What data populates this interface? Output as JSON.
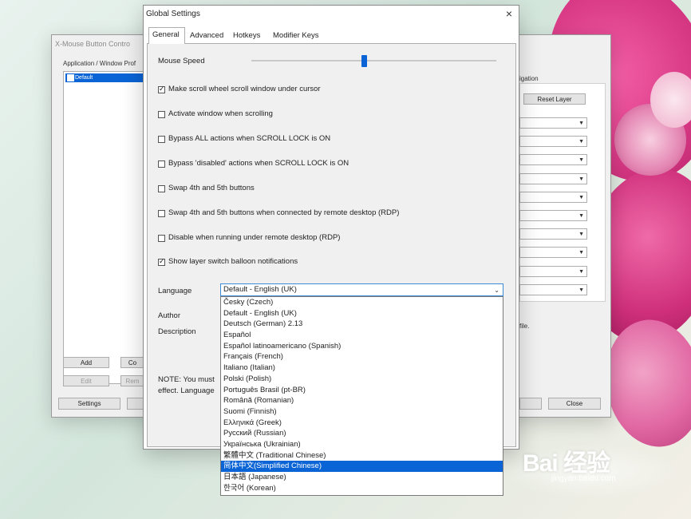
{
  "back_window": {
    "title": "X-Mouse Button Contro",
    "app_list_label": "Application / Window Prof",
    "list_items": [
      "Default"
    ],
    "buttons": {
      "add": "Add",
      "copy": "Co",
      "edit": "Edit",
      "remove": "Rem",
      "settings": "Settings",
      "close": "Close"
    },
    "right_label": "igation",
    "reset_layer": "Reset Layer",
    "profile_note": "file.",
    "combo_count": 10
  },
  "global_settings": {
    "title": "Global Settings",
    "close_glyph": "×",
    "tabs": [
      {
        "label": "General",
        "active": true
      },
      {
        "label": "Advanced",
        "active": false
      },
      {
        "label": "Hotkeys",
        "active": false
      },
      {
        "label": "Modifier Keys",
        "active": false
      }
    ],
    "mouse_speed_label": "Mouse Speed",
    "mouse_speed_value": 0.46,
    "checkboxes": [
      {
        "label": "Make scroll wheel scroll window under cursor",
        "checked": true
      },
      {
        "label": "Activate window when scrolling",
        "checked": false
      },
      {
        "label": "Bypass ALL actions when SCROLL LOCK is ON",
        "checked": false
      },
      {
        "label": "Bypass 'disabled' actions when SCROLL LOCK is ON",
        "checked": false
      },
      {
        "label": "Swap 4th and 5th buttons",
        "checked": false
      },
      {
        "label": "Swap 4th and 5th buttons when connected by remote desktop (RDP)",
        "checked": false
      },
      {
        "label": "Disable when running under remote desktop (RDP)",
        "checked": false
      },
      {
        "label": "Show layer switch balloon notifications",
        "checked": true
      }
    ],
    "language_label": "Language",
    "language_selected": "Default - English (UK)",
    "author_label": "Author",
    "description_label": "Description",
    "note_line1": "NOTE: You must",
    "note_line2": "effect. Language",
    "language_options": [
      "Česky (Czech)",
      "Default - English (UK)",
      "Deutsch (German) 2.13",
      "Español",
      "Español latinoamericano (Spanish)",
      "Français (French)",
      "Italiano (Italian)",
      "Polski (Polish)",
      "Português Brasil (pt-BR)",
      "Română (Romanian)",
      "Suomi (Finnish)",
      "Ελληνικά (Greek)",
      "Русский (Russian)",
      "Українська (Ukrainian)",
      "繁體中文 (Traditional Chinese)",
      "简体中文(Simplified Chinese)",
      "日本語 (Japanese)",
      "한국어 (Korean)"
    ],
    "highlighted_option_index": 15
  },
  "watermark": {
    "main": "Bai 经验",
    "sub": "jingyan.baidu.com"
  }
}
